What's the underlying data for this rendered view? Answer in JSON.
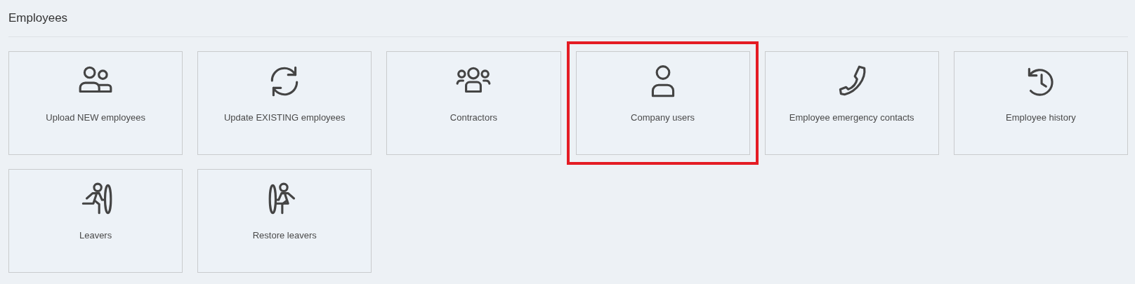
{
  "section": {
    "title": "Employees"
  },
  "tiles": [
    {
      "label": "Upload NEW employees",
      "highlighted": false
    },
    {
      "label": "Update EXISTING employees",
      "highlighted": false
    },
    {
      "label": "Contractors",
      "highlighted": false
    },
    {
      "label": "Company users",
      "highlighted": true
    },
    {
      "label": "Employee emergency contacts",
      "highlighted": false
    },
    {
      "label": "Employee history",
      "highlighted": false
    },
    {
      "label": "Leavers",
      "highlighted": false
    },
    {
      "label": "Restore leavers",
      "highlighted": false
    }
  ]
}
